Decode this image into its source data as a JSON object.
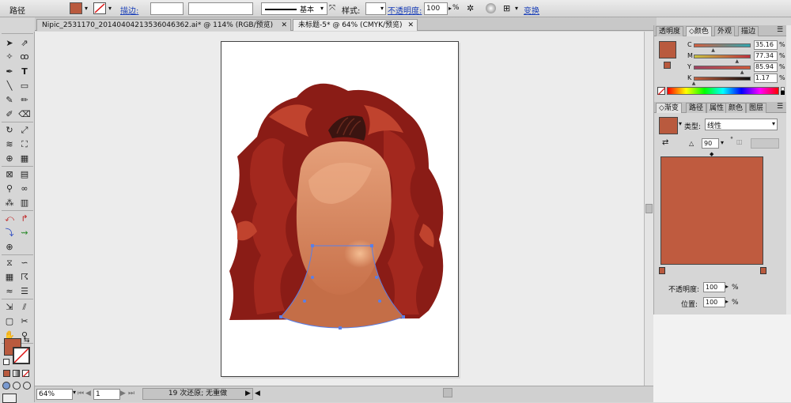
{
  "control_bar": {
    "object_label": "路径",
    "stroke_link": "描边:",
    "stroke_profile": "基本",
    "style_label": "样式:",
    "opacity_link": "不透明度:",
    "opacity_value": "100",
    "opacity_unit": "%",
    "transform_link": "变换"
  },
  "tabs": [
    {
      "label": "Nipic_2531170_20140404213536046362.ai* @ 114% (RGB/预览)",
      "close": "✕"
    },
    {
      "label": "未标题-5* @ 64% (CMYK/预览)",
      "close": "✕"
    }
  ],
  "color_panel": {
    "tabs": [
      "透明度",
      "颜色",
      "外观",
      "描边"
    ],
    "channels": [
      {
        "label": "C",
        "value": "35.16",
        "unit": "%",
        "level": 0.35
      },
      {
        "label": "M",
        "value": "77.34",
        "unit": "%",
        "level": 0.77
      },
      {
        "label": "Y",
        "value": "85.94",
        "unit": "%",
        "level": 0.86
      },
      {
        "label": "K",
        "value": "1.17",
        "unit": "%",
        "level": 0.01
      }
    ]
  },
  "gradient_panel": {
    "tabs": [
      "渐变",
      "路径",
      "属性",
      "颜色",
      "图层"
    ],
    "type_label": "类型:",
    "type_value": "线性",
    "angle_value": "90",
    "angle_unit": "°",
    "opacity_label": "不透明度:",
    "opacity_value": "100",
    "opacity_unit": "%",
    "location_label": "位置:",
    "location_value": "100",
    "location_unit": "%"
  },
  "status_bar": {
    "zoom": "64%",
    "page": "1",
    "undo_text": "19 次还原; 无重做"
  },
  "colors": {
    "fill": "#b95a3e",
    "hair_dark": "#8a1c16",
    "hair_mid": "#a3281e",
    "skin": "#d88a5e",
    "skin_light": "#e9a77c",
    "accent_link": "#1a3fb8"
  }
}
